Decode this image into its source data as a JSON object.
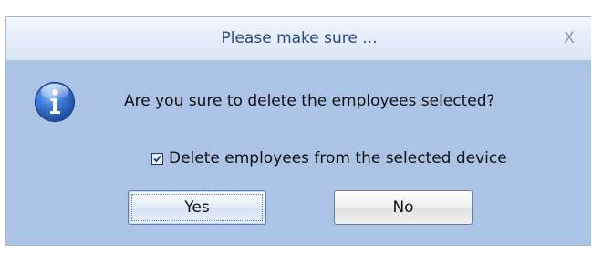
{
  "dialog": {
    "title": "Please make sure ...",
    "close_label": "X",
    "icon": "info-icon",
    "message": "Are you sure to delete the employees selected?",
    "checkbox": {
      "label": "Delete employees from the selected device",
      "checked": true
    },
    "buttons": {
      "yes_label": "Yes",
      "no_label": "No"
    }
  },
  "colors": {
    "body_bg": "#abc4e6",
    "title_text": "#2c4a7c",
    "icon_blue": "#2f66c4"
  }
}
